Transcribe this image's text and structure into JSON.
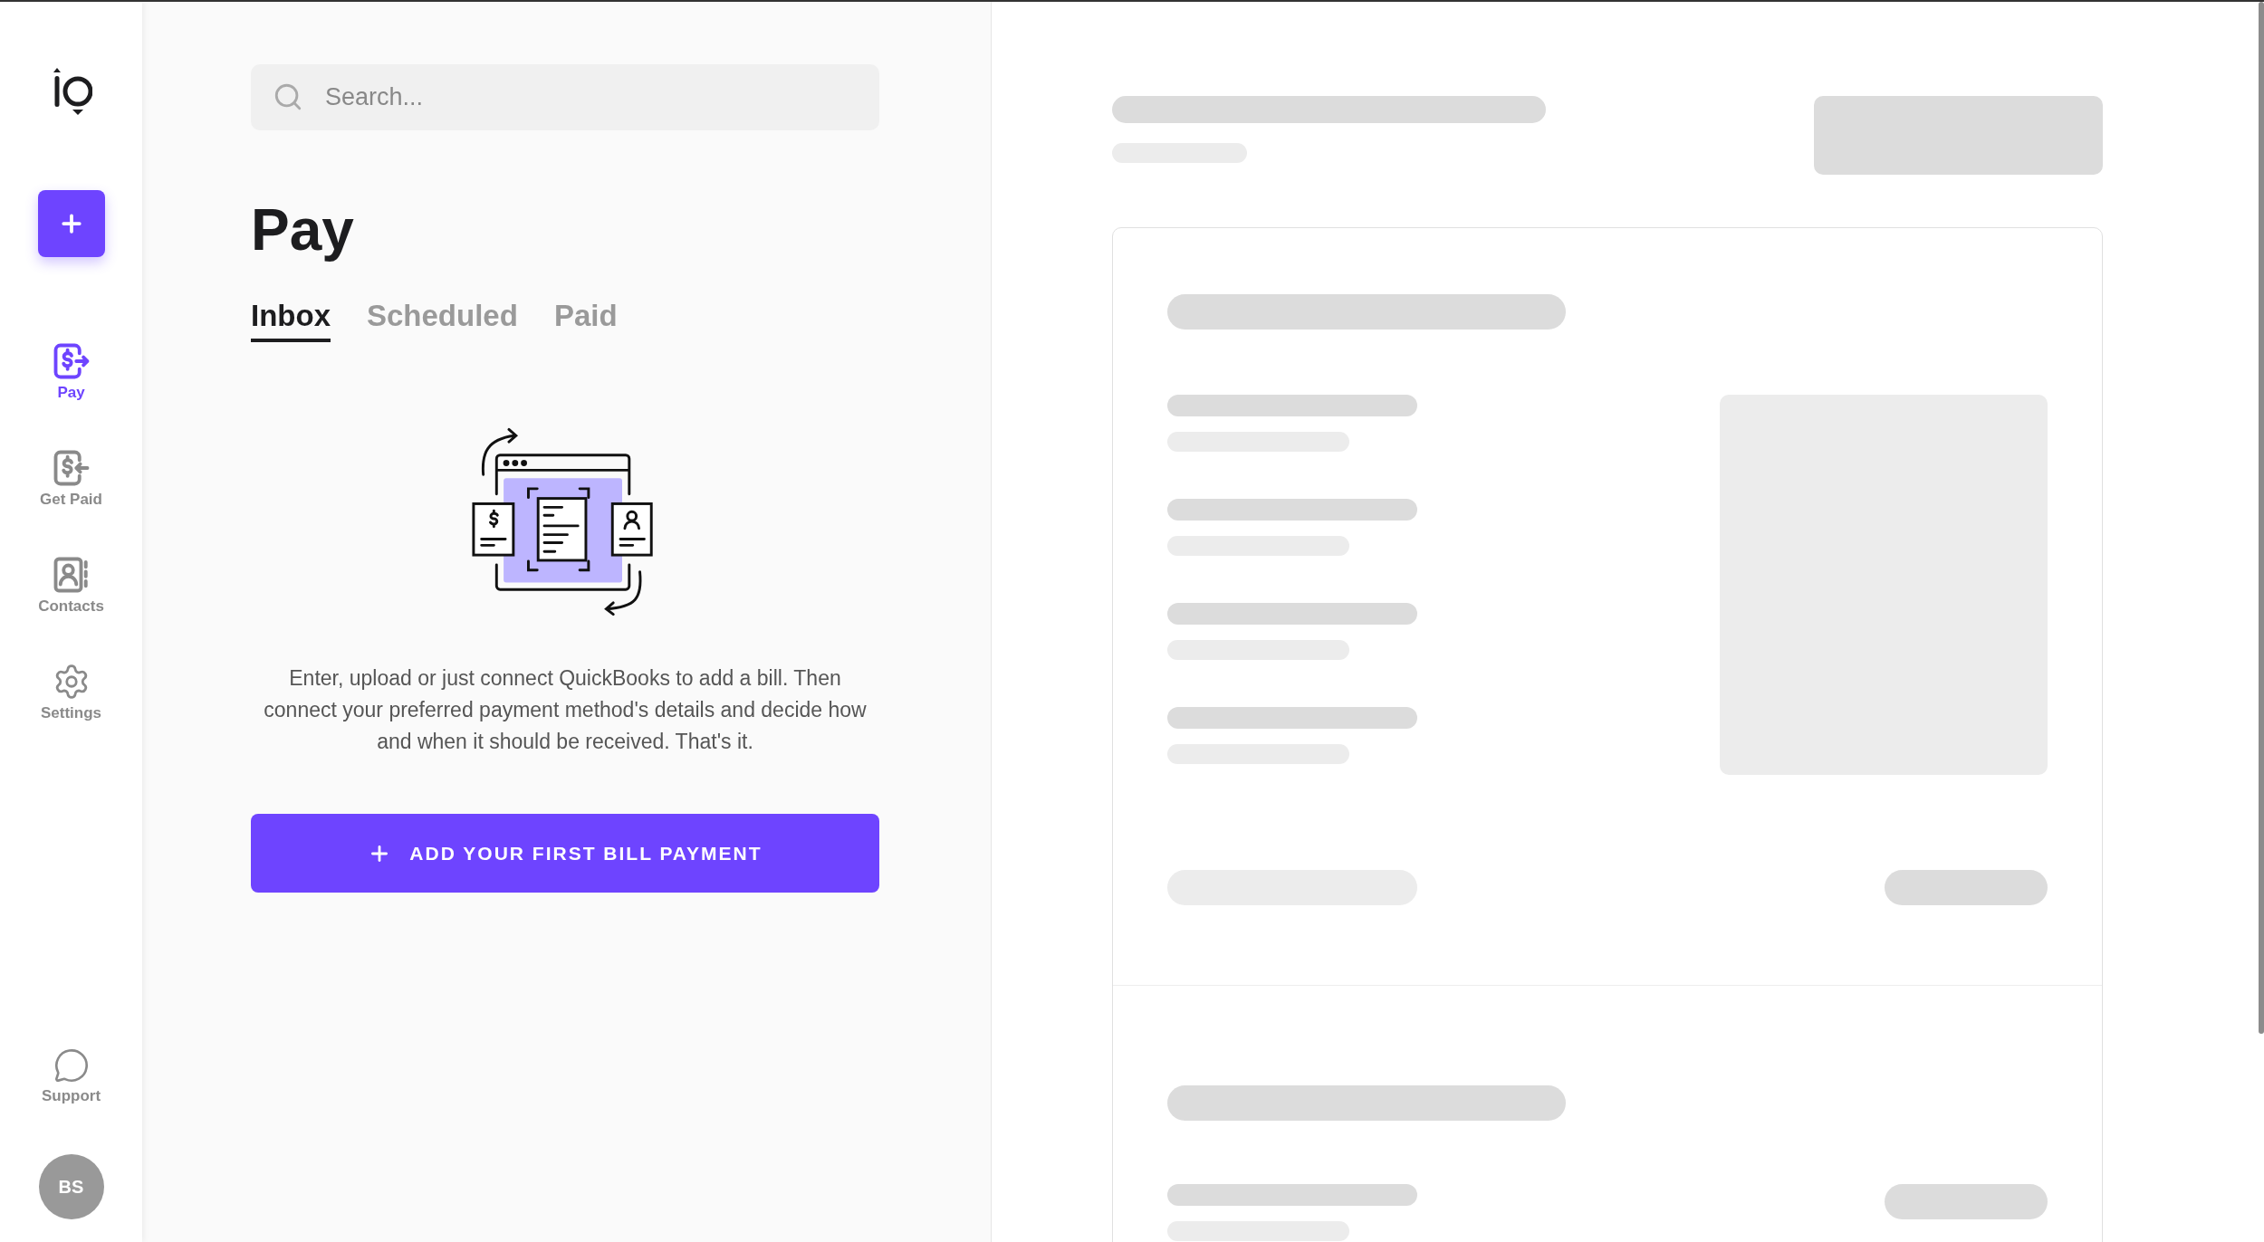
{
  "sidebar": {
    "new_button": {
      "kind": "plus"
    },
    "items": [
      {
        "kind": "pay",
        "label": "Pay",
        "selected": true
      },
      {
        "kind": "get-paid",
        "label": "Get Paid",
        "selected": false
      },
      {
        "kind": "contacts",
        "label": "Contacts",
        "selected": false
      },
      {
        "kind": "settings",
        "label": "Settings",
        "selected": false
      }
    ],
    "support": {
      "label": "Support"
    },
    "avatar": {
      "initials": "BS"
    }
  },
  "search": {
    "placeholder": "Search..."
  },
  "title": "Pay",
  "tabs": [
    {
      "label": "Inbox",
      "selected": true
    },
    {
      "label": "Scheduled",
      "selected": false
    },
    {
      "label": "Paid",
      "selected": false
    }
  ],
  "empty_state": {
    "message": "Enter, upload or just connect QuickBooks to add a bill. Then connect your preferred payment method's details and decide how and when it should be received. That's it.",
    "button": "ADD YOUR FIRST BILL PAYMENT"
  }
}
